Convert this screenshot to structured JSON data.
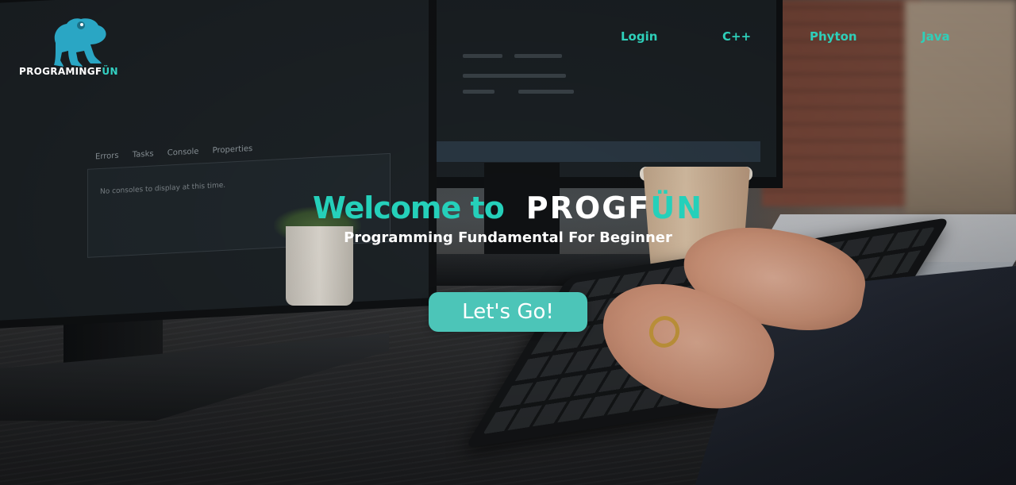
{
  "brand": {
    "logo_icon": "frog-icon",
    "name_main": "PROGRAMINGF",
    "name_accent": "ÜN"
  },
  "nav": {
    "items": [
      {
        "label": "Login"
      },
      {
        "label": "C++"
      },
      {
        "label": "Phyton"
      },
      {
        "label": "Java"
      }
    ]
  },
  "hero": {
    "welcome": "Welcome to",
    "brand_main": "PROGF",
    "brand_accent": "ÜN",
    "subtitle": "Programming Fundamental For Beginner",
    "cta_label": "Let's Go!"
  },
  "background_screen": {
    "tabs": [
      "Errors",
      "Tasks",
      "Console",
      "Properties"
    ],
    "console_message": "No consoles to display at this time."
  },
  "colors": {
    "accent": "#2ecfb9",
    "button": "#4cc5b8",
    "text": "#ffffff"
  }
}
